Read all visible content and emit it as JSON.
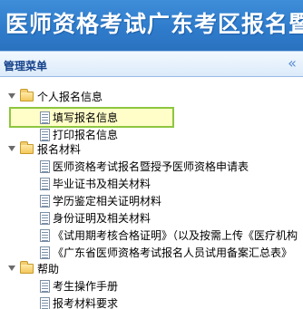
{
  "banner": {
    "title": "医师资格考试广东考区报名暨"
  },
  "panel": {
    "title": "管理菜单",
    "collapse_glyph": "«"
  },
  "tree": {
    "group1": {
      "label": "个人报名信息",
      "items": [
        "填写报名信息",
        "打印报名信息"
      ]
    },
    "group2": {
      "label": "报名材料",
      "items": [
        "医师资格考试报名暨授予医师资格申请表",
        "毕业证书及相关材料",
        "学历鉴定相关证明材料",
        "身份证明及相关材料",
        "《试用期考核合格证明》（以及按需上传《医疗机构",
        "《广东省医师资格考试报名人员试用备案汇总表》"
      ]
    },
    "group3": {
      "label": "帮助",
      "items": [
        "考生操作手册",
        "报考材料要求"
      ]
    }
  }
}
